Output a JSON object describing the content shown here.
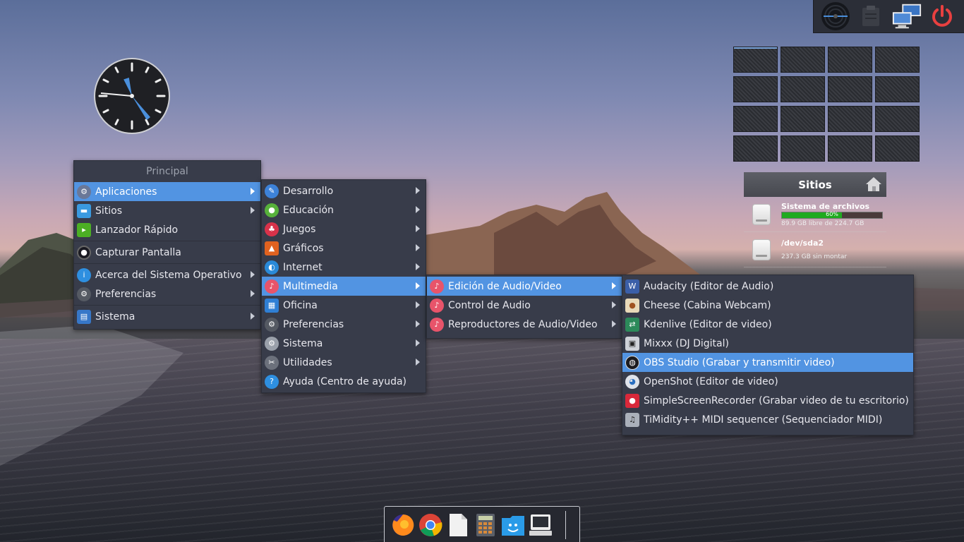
{
  "desktop": {
    "top_panel": {
      "icons": [
        "vinyl-record-icon",
        "clipboard-icon",
        "network-computers-icon",
        "power-icon"
      ]
    },
    "workspaces": {
      "count": 16,
      "active_index": 0
    },
    "places": {
      "title": "Sitios",
      "items": [
        {
          "name": "Sistema de archivos",
          "usage_percent": 60,
          "usage_label": "60%",
          "detail": "89.9 GB libre de 224.7 GB"
        },
        {
          "name": "/dev/sda2",
          "detail": "237.3 GB sin montar"
        }
      ]
    },
    "colors": {
      "accent": "#5294e2",
      "menu_bg": "#383c4a",
      "usage_bar": "#1faa1f"
    }
  },
  "main_menu": {
    "title": "Principal",
    "items": [
      {
        "label": "Aplicaciones",
        "icon": "apps-gear-icon",
        "submenu": true,
        "selected": true
      },
      {
        "label": "Sitios",
        "icon": "folder-icon",
        "submenu": true
      },
      {
        "label": "Lanzador Rápido",
        "icon": "terminal-launch-icon",
        "submenu": false
      },
      {
        "label": "Capturar Pantalla",
        "icon": "camera-icon",
        "submenu": false
      },
      {
        "label": "Acerca del Sistema Operativo",
        "icon": "info-icon",
        "submenu": true
      },
      {
        "label": "Preferencias",
        "icon": "settings-icon",
        "submenu": true
      },
      {
        "label": "Sistema",
        "icon": "system-monitor-icon",
        "submenu": true
      }
    ]
  },
  "apps_menu": {
    "items": [
      {
        "label": "Desarrollo",
        "icon": "development-icon"
      },
      {
        "label": "Educación",
        "icon": "education-icon"
      },
      {
        "label": "Juegos",
        "icon": "games-icon"
      },
      {
        "label": "Gráficos",
        "icon": "graphics-icon"
      },
      {
        "label": "Internet",
        "icon": "internet-icon"
      },
      {
        "label": "Multimedia",
        "icon": "multimedia-icon",
        "selected": true
      },
      {
        "label": "Oficina",
        "icon": "office-icon"
      },
      {
        "label": "Preferencias",
        "icon": "preferences-icon"
      },
      {
        "label": "Sistema",
        "icon": "system-icon"
      },
      {
        "label": "Utilidades",
        "icon": "utilities-icon"
      },
      {
        "label": "Ayuda (Centro de ayuda)",
        "icon": "help-icon"
      }
    ]
  },
  "multimedia_menu": {
    "items": [
      {
        "label": "Edición de Audio/Video",
        "icon": "music-note-icon",
        "selected": true
      },
      {
        "label": "Control de Audio",
        "icon": "music-note-icon"
      },
      {
        "label": "Reproductores de Audio/Video",
        "icon": "music-note-icon"
      }
    ]
  },
  "editing_menu": {
    "items": [
      {
        "label": "Audacity (Editor de Audio)",
        "icon": "audacity-icon"
      },
      {
        "label": "Cheese (Cabina Webcam)",
        "icon": "cheese-icon"
      },
      {
        "label": "Kdenlive (Editor de video)",
        "icon": "kdenlive-icon"
      },
      {
        "label": "Mixxx (DJ Digital)",
        "icon": "mixxx-icon"
      },
      {
        "label": "OBS Studio (Grabar y transmitir video)",
        "icon": "obs-icon",
        "selected": true
      },
      {
        "label": "OpenShot (Editor de video)",
        "icon": "openshot-icon"
      },
      {
        "label": "SimpleScreenRecorder (Grabar video de tu escritorio)",
        "icon": "screen-recorder-icon"
      },
      {
        "label": "TiMidity++ MIDI sequencer (Sequenciador MIDI)",
        "icon": "timidity-icon"
      }
    ]
  },
  "dock": {
    "icons": [
      "firefox-icon",
      "chrome-icon",
      "text-editor-icon",
      "calculator-icon",
      "file-manager-icon",
      "terminal-computer-icon"
    ]
  }
}
